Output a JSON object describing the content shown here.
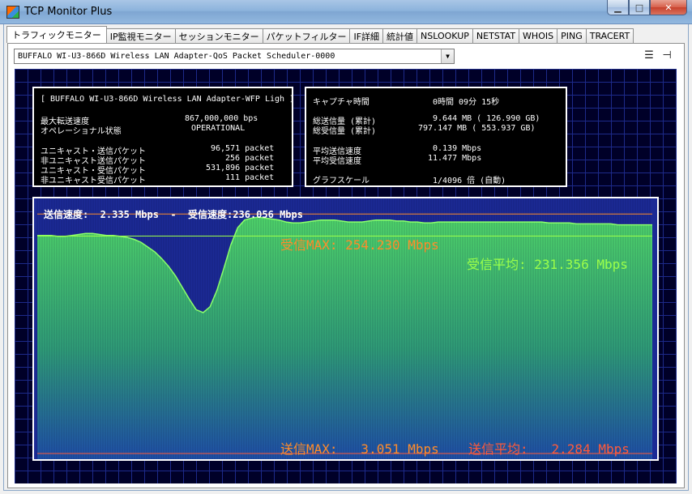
{
  "window": {
    "title": "TCP Monitor Plus"
  },
  "tabs": [
    "トラフィックモニター",
    "IP監視モニター",
    "セッションモニター",
    "パケットフィルター",
    "IF詳細",
    "統計値",
    "NSLOOKUP",
    "NETSTAT",
    "WHOIS",
    "PING",
    "TRACERT"
  ],
  "adapter": {
    "selected": "BUFFALO WI-U3-866D Wireless LAN Adapter-QoS Packet Scheduler-0000"
  },
  "icons": {
    "list": "list-icon",
    "pin": "pin-icon"
  },
  "info_left": {
    "header": "[ BUFFALO WI-U3-866D Wireless LAN Adapter-WFP Ligh ]",
    "max_speed_label": "最大転送速度",
    "max_speed_value": "867,000,000 bps",
    "op_status_label": "オペレーショナル状態",
    "op_status_value": "OPERATIONAL",
    "uni_send_label": "ユニキャスト・送信パケット",
    "uni_send_value": "96,571 packet",
    "nonuni_send_label": "非ユニキャスト送信パケット",
    "nonuni_send_value": "256 packet",
    "uni_recv_label": "ユニキャスト・受信パケット",
    "uni_recv_value": "531,896 packet",
    "nonuni_recv_label": "非ユニキャスト受信パケット",
    "nonuni_recv_value": "111 packet"
  },
  "info_right": {
    "capture_label": "キャプチャ時間",
    "capture_value": "0時間 09分 15秒",
    "total_sent_label": "総送信量 (累計)",
    "total_sent_value": "9.644 MB ( 126.990 GB)",
    "total_recv_label": "総受信量 (累計)",
    "total_recv_value": "797.147 MB ( 553.937 GB)",
    "avg_send_label": "平均送信速度",
    "avg_send_value": "0.139 Mbps",
    "avg_recv_label": "平均受信速度",
    "avg_recv_value": "11.477 Mbps",
    "scale_label": "グラフスケール",
    "scale_value": "1/4096 倍 (自動)"
  },
  "graph": {
    "speed_line": "送信速度:  2.335 Mbps  -  受信速度:236.056 Mbps",
    "recv_max": "受信MAX: 254.230 Mbps",
    "recv_avg": "受信平均: 231.356 Mbps",
    "send_max": "送信MAX:   3.051 Mbps",
    "send_avg": "送信平均:   2.284 Mbps",
    "colors": {
      "recv_max_line": "#ff8c2a",
      "recv_avg_line": "#9cff4a",
      "send_line": "#ff5a3a",
      "bg": "#1c2a95"
    }
  },
  "chart_data": {
    "type": "area",
    "series": [
      {
        "values": [
          232,
          232,
          232,
          231,
          231,
          232,
          233,
          234,
          234,
          233,
          232,
          232,
          231,
          230,
          228,
          225,
          220,
          215,
          208,
          200,
          190,
          178,
          166,
          155,
          152,
          158,
          175,
          198,
          222,
          240,
          248,
          250,
          251,
          250,
          249,
          248,
          246,
          245,
          245,
          246,
          247,
          248,
          248,
          248,
          247,
          246,
          246,
          246,
          247,
          248,
          248,
          248,
          247,
          247,
          246,
          246,
          245,
          245,
          246,
          246,
          246,
          246,
          246,
          246,
          246,
          246,
          246,
          246,
          246,
          246,
          246,
          246,
          246,
          246,
          245,
          245,
          245,
          245,
          244,
          244,
          244,
          244,
          244,
          244,
          243,
          243,
          243,
          243,
          243,
          243
        ]
      }
    ],
    "reference_lines": [
      254.23,
      231.356,
      3.051,
      2.284
    ],
    "ylim": [
      0,
      262
    ]
  }
}
